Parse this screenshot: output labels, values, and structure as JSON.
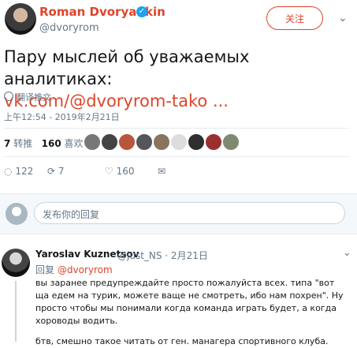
{
  "tweet": {
    "name": "Roman Dvoryankin",
    "handle": "@dvoryrom",
    "follow_label": "关注",
    "text_line1": "Пару мыслей об уважаемых аналитиках:",
    "link": "vk.com/@dvoryrom-tako ...",
    "translate": "翻译推文",
    "date": "上午12:54 - 2019年2月21日",
    "retweets_count": "7",
    "retweets_label": "转推",
    "likes_count": "160",
    "likes_label": "喜欢",
    "reply_count": "122",
    "retweet_action_count": "7",
    "like_action_count": "160"
  },
  "reply_box": {
    "placeholder": "发布你的回复"
  },
  "reply": {
    "name": "Yaroslav Kuznetsov",
    "handle": "@just_NS · 2月21日",
    "replying_prefix": "回复",
    "replying_handle": "@dvoryrom",
    "text1": "вы заранее предупреждайте просто пожалуйста всех. типа \"вот ща едем на турик, можете ваще не смотреть, ибо нам похрен\". Ну просто чтобы мы понимали когда команда играть будет, а когда хороводы водить.",
    "text2": "бтв, смешно такое читать от ген. манагера спортивного клуба."
  },
  "colors": {
    "accent": "#e0442a",
    "muted": "#657786",
    "verified": "#1da1f2"
  },
  "icons": [
    "verified-icon",
    "globe-icon",
    "reply-icon",
    "retweet-icon",
    "heart-icon",
    "message-icon",
    "chevron-down-icon"
  ]
}
